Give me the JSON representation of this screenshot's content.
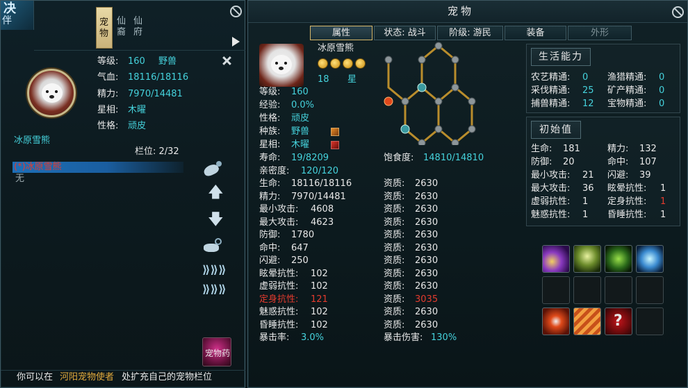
{
  "left_panel": {
    "logo_text": "决",
    "logo_text2": "伴",
    "tabs": [
      "宠物",
      "仙裔",
      "仙府"
    ],
    "info": {
      "level_label": "等级:",
      "level_value": "160",
      "type_value": "野兽",
      "hp_label": "气血:",
      "hp_value": "18116/18116",
      "mp_label": "精力:",
      "mp_value": "7970/14481",
      "star_label": "星相:",
      "star_value": "木曜",
      "nature_label": "性格:",
      "nature_value": "顽皮"
    },
    "pet_name": "冰原雪熊",
    "slot_text": "栏位: 2/32",
    "list": [
      {
        "name": "(*)冰原雪熊"
      },
      {
        "name": "无"
      }
    ],
    "potion_label": "宠物药",
    "footer": {
      "prefix": "你可以在",
      "highlight": "河阳宠物使者",
      "suffix": "处扩充自己的宠物栏位"
    }
  },
  "right_panel": {
    "title": "宠物",
    "tabs": [
      "属性",
      "状态: 战斗",
      "阶级: 游民",
      "装备",
      "外形"
    ],
    "pet_name": "冰原雪熊",
    "star_count": "18",
    "star_unit": "星",
    "basic": [
      {
        "label": "等级:",
        "value": "160"
      },
      {
        "label": "经验:",
        "value": "0.0%"
      },
      {
        "label": "性格:",
        "value": "顽皮"
      },
      {
        "label": "种族:",
        "value": "野兽"
      },
      {
        "label": "星相:",
        "value": "木曜"
      },
      {
        "label": "寿命:",
        "value": "19/8209"
      },
      {
        "label": "亲密度:",
        "value": "120/120"
      }
    ],
    "satiety_label": "饱食度:",
    "satiety_value": "14810/14810",
    "stats": [
      {
        "label": "生命:",
        "value": "18116/18116",
        "apt_label": "资质:",
        "apt": "2630"
      },
      {
        "label": "精力:",
        "value": "7970/14481",
        "apt_label": "资质:",
        "apt": "2630"
      },
      {
        "label": "最小攻击:",
        "value": "4608",
        "apt_label": "资质:",
        "apt": "2630"
      },
      {
        "label": "最大攻击:",
        "value": "4623",
        "apt_label": "资质:",
        "apt": "2630"
      },
      {
        "label": "防御:",
        "value": "1780",
        "apt_label": "资质:",
        "apt": "2630"
      },
      {
        "label": "命中:",
        "value": "647",
        "apt_label": "资质:",
        "apt": "2630"
      },
      {
        "label": "闪避:",
        "value": "250",
        "apt_label": "资质:",
        "apt": "2630"
      },
      {
        "label": "眩晕抗性:",
        "value": "102",
        "apt_label": "资质:",
        "apt": "2630"
      },
      {
        "label": "虚弱抗性:",
        "value": "102",
        "apt_label": "资质:",
        "apt": "2630"
      },
      {
        "label": "定身抗性:",
        "value": "121",
        "apt_label": "资质:",
        "apt": "3035"
      },
      {
        "label": "魅惑抗性:",
        "value": "102",
        "apt_label": "资质:",
        "apt": "2630"
      },
      {
        "label": "昏睡抗性:",
        "value": "102",
        "apt_label": "资质:",
        "apt": "2630"
      }
    ],
    "crit_rate_label": "暴击率:",
    "crit_rate": "3.0%",
    "crit_dmg_label": "暴击伤害:",
    "crit_dmg": "130%",
    "life_skills": {
      "title": "生活能力",
      "items": [
        {
          "label": "农艺精通:",
          "value": "0"
        },
        {
          "label": "渔猎精通:",
          "value": "0"
        },
        {
          "label": "采伐精通:",
          "value": "25"
        },
        {
          "label": "矿产精通:",
          "value": "0"
        },
        {
          "label": "捕兽精通:",
          "value": "12"
        },
        {
          "label": "宝物精通:",
          "value": "0"
        }
      ]
    },
    "initial": {
      "title": "初始值",
      "items": [
        {
          "label": "生命:",
          "value": "181"
        },
        {
          "label": "精力:",
          "value": "132"
        },
        {
          "label": "防御:",
          "value": "20"
        },
        {
          "label": "命中:",
          "value": "107"
        },
        {
          "label": "最小攻击:",
          "value": "21"
        },
        {
          "label": "闪避:",
          "value": "39"
        },
        {
          "label": "最大攻击:",
          "value": "36"
        },
        {
          "label": "眩晕抗性:",
          "value": "1"
        },
        {
          "label": "虚弱抗性:",
          "value": "1"
        },
        {
          "label": "定身抗性:",
          "value": "1"
        },
        {
          "label": "魅惑抗性:",
          "value": "1"
        },
        {
          "label": "昏睡抗性:",
          "value": "1"
        }
      ]
    },
    "question_mark": "?"
  },
  "colors": {
    "cyan": "#45d2dc",
    "red": "#e33b2e",
    "gold": "#d6b76a"
  }
}
